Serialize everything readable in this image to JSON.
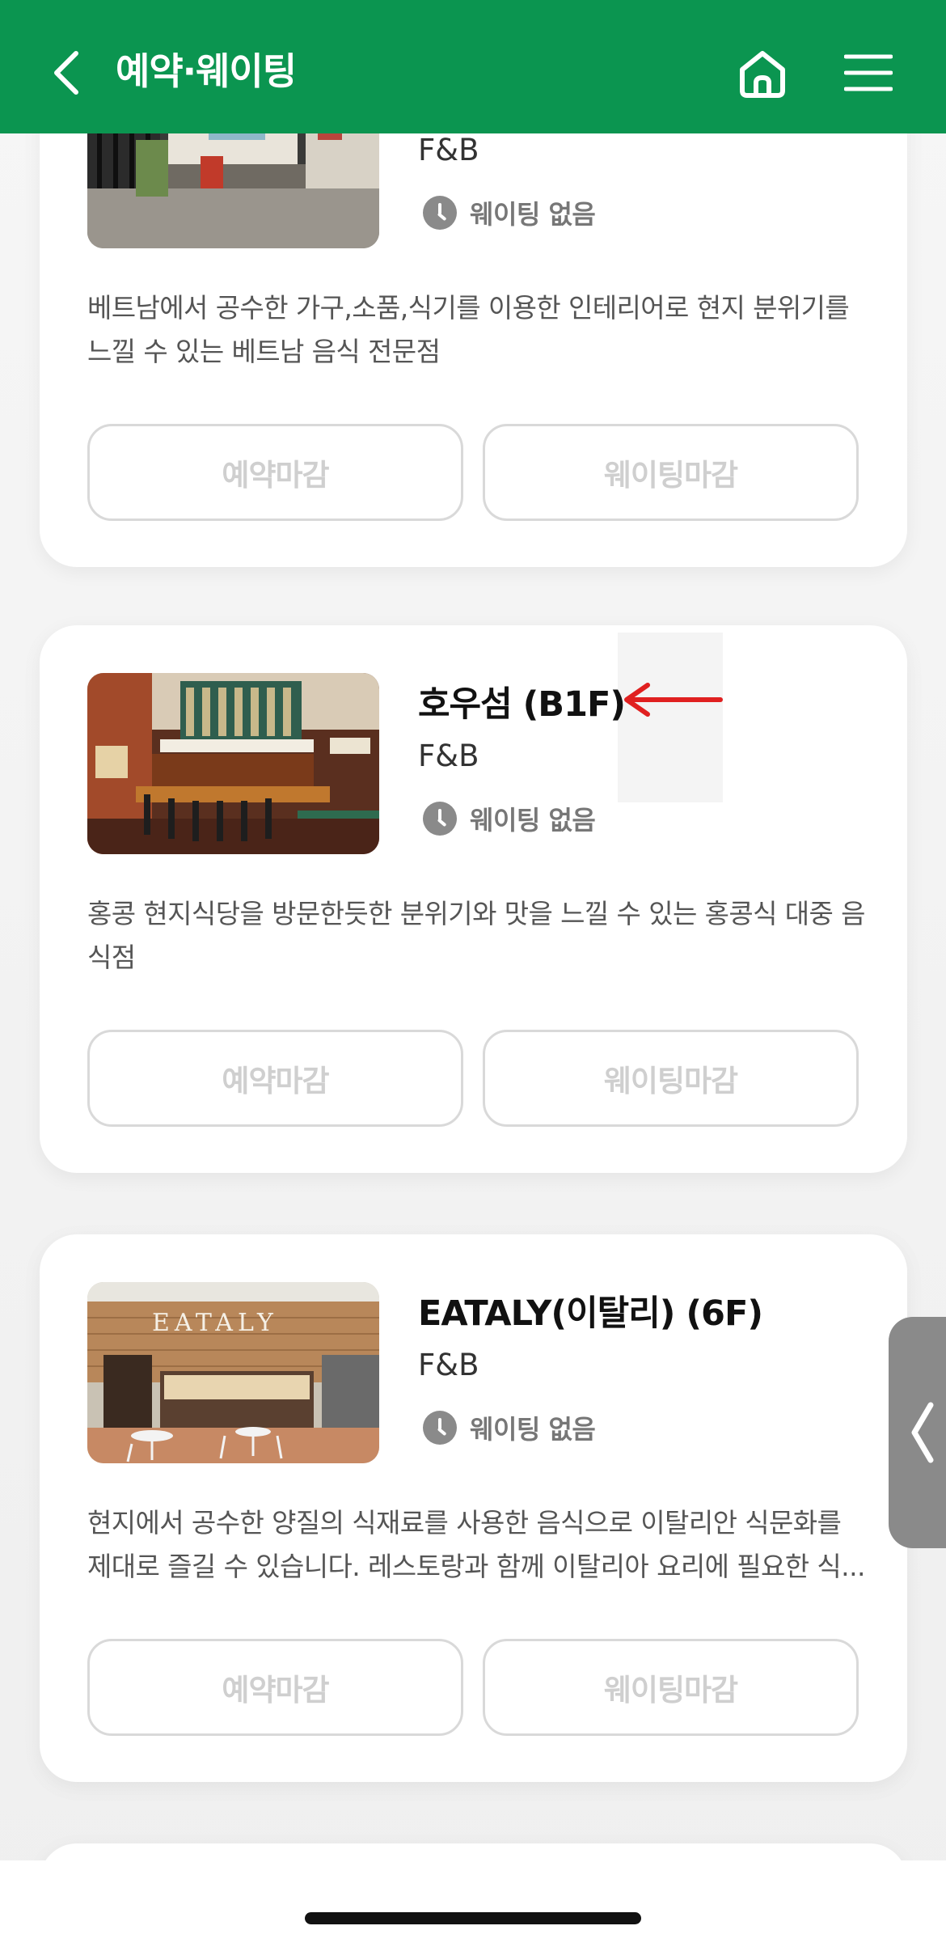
{
  "header": {
    "title": "예약·웨이팅",
    "background": "#0b9550"
  },
  "stores": [
    {
      "name": "",
      "category": "F&B",
      "wait_status": "웨이팅 없음",
      "description": "베트남에서 공수한 가구,소품,식기를 이용한 인테리어로 현지 분위기를 느낄 수 있는 베트남 음식 전문점",
      "reserve_label": "예약마감",
      "waiting_label": "웨이팅마감"
    },
    {
      "name": "호우섬 (B1F)",
      "category": "F&B",
      "wait_status": "웨이팅 없음",
      "description": "홍콩 현지식당을 방문한듯한 분위기와 맛을 느낄 수 있는 홍콩식 대중 음식점",
      "reserve_label": "예약마감",
      "waiting_label": "웨이팅마감"
    },
    {
      "name": "EATALY(이탈리) (6F)",
      "category": "F&B",
      "wait_status": "웨이팅 없음",
      "description": "현지에서 공수한 양질의 식재료를 사용한 음식으로 이탈리안 식문화를 제대로 즐길 수 있습니다. 레스토랑과 함께 이탈리아 요리에 필요한 식...",
      "reserve_label": "예약마감",
      "waiting_label": "웨이팅마감",
      "sign_text": "EATALY"
    }
  ],
  "colors": {
    "annotation_arrow": "#e02020",
    "disabled_text": "#cfcfcf"
  },
  "icons": {
    "back": "chevron-left-icon",
    "home": "home-icon",
    "menu": "hamburger-menu-icon",
    "clock": "clock-icon",
    "side_tab": "chevron-left-icon"
  }
}
